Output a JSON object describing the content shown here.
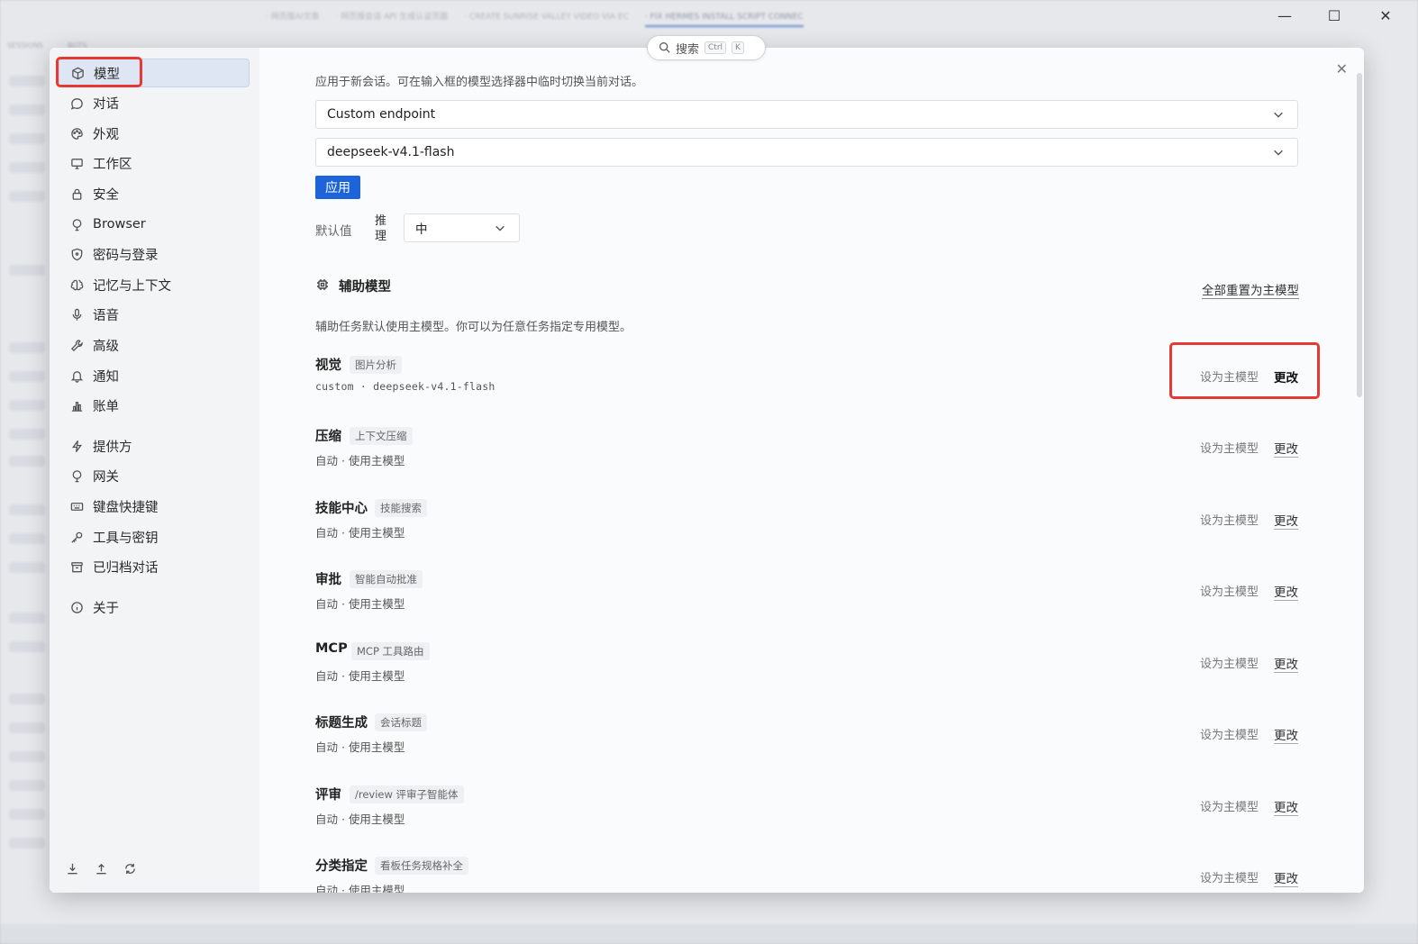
{
  "bg": {
    "tabs": [
      "· 网页版AI文章",
      "· 网页版会话 API 生成认证页面",
      "· CREATE SUNRISE VALLEY VIDEO VIA EC",
      "· FIX HERMES INSTALL SCRIPT CONNEC"
    ],
    "sessions_label": "SESSIONS",
    "bots_label": "BOTS"
  },
  "search": {
    "placeholder": "搜索",
    "kbd1": "Ctrl",
    "kbd2": "K"
  },
  "sidebar": {
    "items": [
      {
        "label": "模型",
        "icon": "cube-icon"
      },
      {
        "label": "对话",
        "icon": "chat-bubble-icon"
      },
      {
        "label": "外观",
        "icon": "palette-icon"
      },
      {
        "label": "工作区",
        "icon": "monitor-icon"
      },
      {
        "label": "安全",
        "icon": "lock-icon"
      },
      {
        "label": "Browser",
        "icon": "browser-globe-icon"
      },
      {
        "label": "密码与登录",
        "icon": "shield-icon"
      },
      {
        "label": "记忆与上下文",
        "icon": "brain-icon"
      },
      {
        "label": "语音",
        "icon": "microphone-icon"
      },
      {
        "label": "高级",
        "icon": "wrench-icon"
      },
      {
        "label": "通知",
        "icon": "bell-icon"
      },
      {
        "label": "账单",
        "icon": "bar-chart-icon"
      },
      {
        "label": "提供方",
        "icon": "bolt-icon"
      },
      {
        "label": "网关",
        "icon": "gateway-pin-icon"
      },
      {
        "label": "键盘快捷键",
        "icon": "keyboard-icon"
      },
      {
        "label": "工具与密钥",
        "icon": "key-icon"
      },
      {
        "label": "已归档对话",
        "icon": "archive-icon"
      },
      {
        "label": "关于",
        "icon": "info-icon"
      }
    ]
  },
  "main": {
    "top_desc": "应用于新会话。可在输入框的模型选择器中临时切换当前对话。",
    "provider_select": "Custom endpoint",
    "model_select": "deepseek-v4.1-flash",
    "apply_label": "应用",
    "default_label": "默认值",
    "reasoning_label": "推理",
    "reasoning_value": "中",
    "aux_title": "辅助模型",
    "reset_all": "全部重置为主模型",
    "aux_desc": "辅助任务默认使用主模型。你可以为任意任务指定专用模型。",
    "set_main_label": "设为主模型",
    "change_label": "更改",
    "tasks": [
      {
        "name": "视觉",
        "tag": "图片分析",
        "meta": "custom · deepseek-v4.1-flash"
      },
      {
        "name": "压缩",
        "tag": "上下文压缩",
        "meta": "自动 · 使用主模型"
      },
      {
        "name": "技能中心",
        "tag": "技能搜索",
        "meta": "自动 · 使用主模型"
      },
      {
        "name": "审批",
        "tag": "智能自动批准",
        "meta": "自动 · 使用主模型"
      },
      {
        "name": "MCP",
        "tag": "MCP 工具路由",
        "meta": "自动 · 使用主模型"
      },
      {
        "name": "标题生成",
        "tag": "会话标题",
        "meta": "自动 · 使用主模型"
      },
      {
        "name": "评审",
        "tag": "/review 评审子智能体",
        "meta": "自动 · 使用主模型"
      },
      {
        "name": "分类指定",
        "tag": "看板任务规格补全",
        "meta": "自动 · 使用主模型"
      }
    ]
  }
}
